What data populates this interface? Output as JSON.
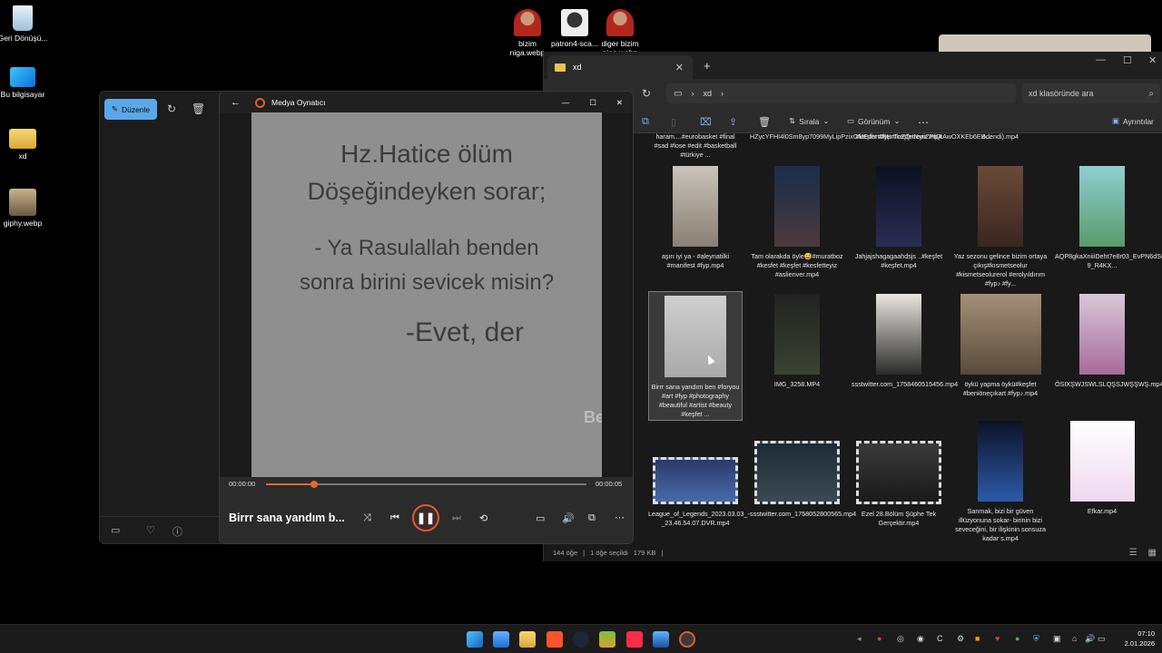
{
  "desktop": {
    "icons": [
      {
        "label": "Geri Dönüşü...",
        "icon": "recycle-bin-icon"
      },
      {
        "label": "Bu bilgisayar",
        "icon": "monitor-icon"
      },
      {
        "label": "xd",
        "icon": "folder-icon"
      },
      {
        "label": "giphy.webp",
        "icon": "image-icon"
      },
      {
        "label": "bizim niga.webp",
        "icon": "image-icon"
      },
      {
        "label": "patron4-sca...",
        "icon": "image-icon"
      },
      {
        "label": "diger bizim niga.webp",
        "icon": "image-icon"
      }
    ]
  },
  "photos": {
    "edit_label": "Düzenle"
  },
  "player": {
    "title": "Medya Oynatıcı",
    "time_elapsed": "00:00:00",
    "time_total": "00:00:05",
    "progress": 0.15,
    "now_playing": "Birrr sana yandım b...",
    "video_lines": [
      "Hz.Hatice ölüm",
      "Döşeğindeyken sorar;",
      "- Ya Rasulallah benden",
      "sonra birini sevicek misin?",
      "-Evet, der"
    ],
    "watermark": "Be"
  },
  "explorer": {
    "tab_title": "xd",
    "breadcrumb": [
      "xd"
    ],
    "search_placeholder": "xd klasöründe ara",
    "commands": {
      "sort": "Sırala",
      "view": "Görünüm",
      "details": "Ayrıntılar"
    },
    "files": [
      {
        "name": "haram....#eurobasket #final #sad #lose #edit #basketball #türkiye ..."
      },
      {
        "name": "HZycYFHI4l0Sm8yp7099MyLipPzixGMEdhrt08HrTnZQnNxriZPfQtAwOXKEb6EB..."
      },
      {
        "name": "#keşfet #fyp #keşfetteyiz.mp4"
      },
      {
        "name": "ödendi).mp4"
      },
      {
        "name": ""
      },
      {
        "name": "aşırı iyi ya - #aleynatilki #manifest #fyp.mp4"
      },
      {
        "name": "Tam olarakda öyle😅#muratboz #kesfet #keşfet #kesfetteyiz #aslienver.mp4"
      },
      {
        "name": "Jahjajshagagaahdsjs ..#keşfet #keşfet.mp4"
      },
      {
        "name": "Yaz sezonu gelince bizim ortaya çıkış#kısmetseolur #kismetseolurerol #erolyıldırım #fyp♪ #fy..."
      },
      {
        "name": "AQP8gkaXniiiDeht7e8r03_EvPN6dS6pGGE1E9y3HLEgdDT8DPfu2C7_M0WahyeNUQ3afcnJq3TnvyP-9_R4KX..."
      },
      {
        "name": "Birrr sana yandım ben #foryou #art #fyp #photography #beautiful #artist #beauty #keşfet ..."
      },
      {
        "name": "IMG_3258.MP4"
      },
      {
        "name": "ssstwitter.com_1758460515456.mp4"
      },
      {
        "name": "öykü yapma öykü#keşfet #beniöneçıkart #fyp♪.mp4"
      },
      {
        "name": "ÖSIXŞWJSWLSLQŞSJWŞŞWŞ.mp4"
      },
      {
        "name": "League_of_Legends_2023.03.03_-_23.46.54.07.DVR.mp4"
      },
      {
        "name": "ssstwitter.com_1758052800565.mp4"
      },
      {
        "name": "Ezel 28.Bölüm Şüphe Tek Gerçektir.mp4"
      },
      {
        "name": "Sanmak, bizi bir güven illüzyonuna sokar- birinin bizi seveceğini, bir ilişkinin sonsuza kadar s.mp4"
      },
      {
        "name": "Efkar.mp4"
      }
    ],
    "status": {
      "count": "144 öğe",
      "selected": "1 öğe seçildi",
      "size": "179 KB"
    }
  },
  "taskbar": {
    "time": "07:10",
    "date": "2.01.2026"
  }
}
